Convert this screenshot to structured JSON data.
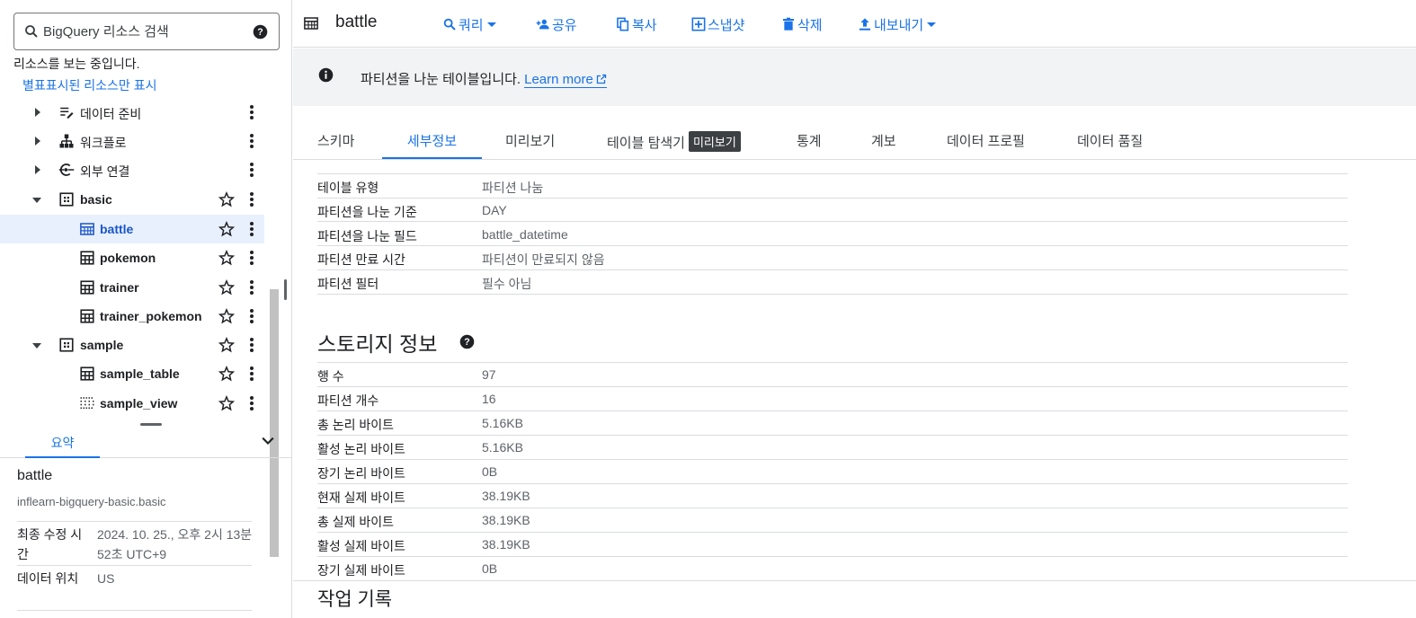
{
  "search": {
    "placeholder": "BigQuery 리소스 검색"
  },
  "sidebar": {
    "viewing_text": "리소스를 보는 중입니다.",
    "starred_link": "별표표시된 리소스만 표시",
    "tree": [
      {
        "label": "데이터 준비"
      },
      {
        "label": "워크플로"
      },
      {
        "label": "외부 연결"
      },
      {
        "label": "basic"
      },
      {
        "label": "battle"
      },
      {
        "label": "pokemon"
      },
      {
        "label": "trainer"
      },
      {
        "label": "trainer_pokemon"
      },
      {
        "label": "sample"
      },
      {
        "label": "sample_table"
      },
      {
        "label": "sample_view"
      }
    ],
    "summary": {
      "tab_label": "요약",
      "title": "battle",
      "subtitle": "inflearn-bigquery-basic.basic",
      "rows": [
        {
          "key": "최종 수정 시간",
          "value": "2024. 10. 25., 오후 2시 13분 52초 UTC+9"
        },
        {
          "key": "데이터 위치",
          "value": "US"
        }
      ]
    }
  },
  "header": {
    "title": "battle",
    "actions": {
      "query": "쿼리",
      "share": "공유",
      "copy": "복사",
      "snapshot": "스냅샷",
      "delete": "삭제",
      "export": "내보내기"
    }
  },
  "banner": {
    "message": "파티션을 나눈 테이블입니다.",
    "learn_more": "Learn more"
  },
  "tabs": {
    "schema": "스키마",
    "details": "세부정보",
    "preview": "미리보기",
    "explorer": "테이블 탐색기",
    "explorer_badge": "미리보기",
    "stats": "통계",
    "lineage": "계보",
    "profile": "데이터 프로필",
    "quality": "데이터 품질"
  },
  "table_info": [
    {
      "key": "테이블 유형",
      "value": "파티션 나눔"
    },
    {
      "key": "파티션을 나눈 기준",
      "value": "DAY"
    },
    {
      "key": "파티션을 나눈 필드",
      "value": "battle_datetime"
    },
    {
      "key": "파티션 만료 시간",
      "value": "파티션이 만료되지 않음"
    },
    {
      "key": "파티션 필터",
      "value": "필수 아님"
    }
  ],
  "storage": {
    "title": "스토리지 정보",
    "rows": [
      {
        "key": "행 수",
        "value": "97"
      },
      {
        "key": "파티션 개수",
        "value": "16"
      },
      {
        "key": "총 논리 바이트",
        "value": "5.16KB"
      },
      {
        "key": "활성 논리 바이트",
        "value": "5.16KB"
      },
      {
        "key": "장기 논리 바이트",
        "value": "0B"
      },
      {
        "key": "현재 실제 바이트",
        "value": "38.19KB"
      },
      {
        "key": "총 실제 바이트",
        "value": "38.19KB"
      },
      {
        "key": "활성 실제 바이트",
        "value": "38.19KB"
      },
      {
        "key": "장기 실제 바이트",
        "value": "0B"
      }
    ]
  },
  "history": {
    "title": "작업 기록"
  },
  "colors": {
    "accent": "#1a73e8",
    "selected_bg": "#e8f0fe",
    "banner_bg": "#f1f3f4",
    "border": "#dadce0"
  }
}
